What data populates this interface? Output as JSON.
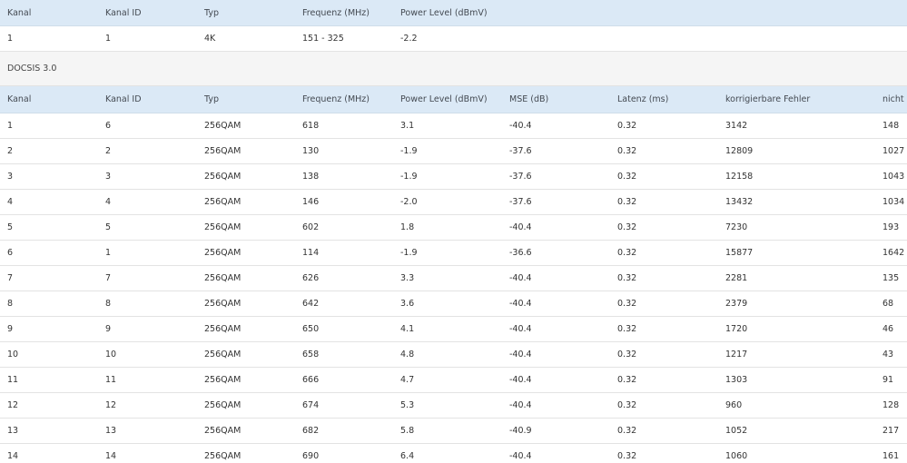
{
  "docsis31": {
    "headers": [
      "Kanal",
      "Kanal ID",
      "Typ",
      "Frequenz (MHz)",
      "Power Level (dBmV)"
    ],
    "rows": [
      [
        "1",
        "1",
        "4K",
        "151 - 325",
        "-2.2"
      ]
    ]
  },
  "docsis30": {
    "section_label": "DOCSIS 3.0",
    "headers": [
      "Kanal",
      "Kanal ID",
      "Typ",
      "Frequenz (MHz)",
      "Power Level (dBmV)",
      "MSE (dB)",
      "Latenz (ms)",
      "korrigierbare Fehler",
      "nicht k"
    ],
    "rows": [
      [
        "1",
        "6",
        "256QAM",
        "618",
        "3.1",
        "-40.4",
        "0.32",
        "3142",
        "148"
      ],
      [
        "2",
        "2",
        "256QAM",
        "130",
        "-1.9",
        "-37.6",
        "0.32",
        "12809",
        "1027"
      ],
      [
        "3",
        "3",
        "256QAM",
        "138",
        "-1.9",
        "-37.6",
        "0.32",
        "12158",
        "1043"
      ],
      [
        "4",
        "4",
        "256QAM",
        "146",
        "-2.0",
        "-37.6",
        "0.32",
        "13432",
        "1034"
      ],
      [
        "5",
        "5",
        "256QAM",
        "602",
        "1.8",
        "-40.4",
        "0.32",
        "7230",
        "193"
      ],
      [
        "6",
        "1",
        "256QAM",
        "114",
        "-1.9",
        "-36.6",
        "0.32",
        "15877",
        "1642"
      ],
      [
        "7",
        "7",
        "256QAM",
        "626",
        "3.3",
        "-40.4",
        "0.32",
        "2281",
        "135"
      ],
      [
        "8",
        "8",
        "256QAM",
        "642",
        "3.6",
        "-40.4",
        "0.32",
        "2379",
        "68"
      ],
      [
        "9",
        "9",
        "256QAM",
        "650",
        "4.1",
        "-40.4",
        "0.32",
        "1720",
        "46"
      ],
      [
        "10",
        "10",
        "256QAM",
        "658",
        "4.8",
        "-40.4",
        "0.32",
        "1217",
        "43"
      ],
      [
        "11",
        "11",
        "256QAM",
        "666",
        "4.7",
        "-40.4",
        "0.32",
        "1303",
        "91"
      ],
      [
        "12",
        "12",
        "256QAM",
        "674",
        "5.3",
        "-40.4",
        "0.32",
        "960",
        "128"
      ],
      [
        "13",
        "13",
        "256QAM",
        "682",
        "5.8",
        "-40.9",
        "0.32",
        "1052",
        "217"
      ],
      [
        "14",
        "14",
        "256QAM",
        "690",
        "6.4",
        "-40.4",
        "0.32",
        "1060",
        "161"
      ]
    ]
  },
  "colors": {
    "header_background": "#dbe9f6",
    "section_background": "#f5f5f5",
    "row_divider": "#e3e3e3",
    "text": "#333333"
  }
}
